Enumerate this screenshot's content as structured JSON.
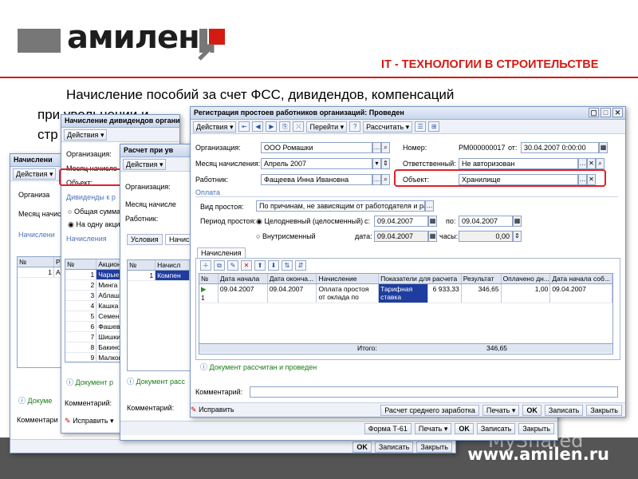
{
  "header": {
    "logo": "амилен",
    "tagline": "IT - ТЕХНОЛОГИИ В СТРОИТЕЛЬСТВЕ",
    "brand_color": "#d51a12"
  },
  "slide_title": "Начисление пособий за счет ФСС, дивидендов, компенсаций при увольнении и регистрация простоев по причинам, не зависящим от работодателя и работника стр",
  "slide_title_line1": "Начисление пособий за счет ФСС, дивидендов, компенсаций",
  "slide_title_line2": "при увольнении и",
  "slide_title_line3": "стр",
  "win1": {
    "title": "Начислени",
    "actions": "Действия",
    "org_label": "Организа",
    "month_label": "Месяц начис",
    "section": "Начислени",
    "col_n": "№",
    "row_n": "1",
    "info": "Докуме",
    "comment_label": "Комментари"
  },
  "win2": {
    "title": "Начисление дивидендов организ",
    "actions": "Действия",
    "org_label": "Организация:",
    "month_label": "Месяц начисле",
    "object_label": "Объект:",
    "div_section": "Дивиденды к р",
    "radio1": "Общая сумма",
    "radio2": "На одну акцию",
    "section": "Начисления",
    "col_n": "№",
    "col_s": "Акцион",
    "rows": [
      {
        "n": "1",
        "name": "Чарые"
      },
      {
        "n": "2",
        "name": "Минга"
      },
      {
        "n": "3",
        "name": "Аблаш"
      },
      {
        "n": "4",
        "name": "Кашка"
      },
      {
        "n": "5",
        "name": "Семен"
      },
      {
        "n": "6",
        "name": "Фашев"
      },
      {
        "n": "7",
        "name": "Шишки"
      },
      {
        "n": "8",
        "name": "Бакино"
      },
      {
        "n": "9",
        "name": "Малков"
      }
    ],
    "info": "Документ р",
    "comment_label": "Комментарий:",
    "fix": "Исправить"
  },
  "win3": {
    "title": "Расчет при ув",
    "actions": "Действия",
    "org_label": "Организация:",
    "month_label": "Месяц начисле",
    "worker_label": "Работник:",
    "tab1": "Условия",
    "tab2": "Начис",
    "col_n": "№",
    "col_name": "Начисл",
    "row_n": "1",
    "row_name": "Компен",
    "info": "Документ расс",
    "comment_label": "Комментарий:",
    "form_btn": "Форма Т-61",
    "print_btn": "Печать",
    "ok": "OK",
    "save": "Записать",
    "close": "Закрыть"
  },
  "win4": {
    "title": "Регистрация простоев работников организаций: Проведен",
    "actions": "Действия",
    "goto": "Перейти",
    "calc": "Рассчитать",
    "org_label": "Организация:",
    "org_value": "ООО Ромашки",
    "month_label": "Месяц начисления:",
    "month_value": "Апрель 2007",
    "worker_label": "Работник:",
    "worker_value": "Фащеева Инна Ивановна",
    "number_label": "Номер:",
    "number_value": "РМ000000017",
    "from_label": "от:",
    "date_value": "30.04.2007 0:00:00",
    "resp_label": "Ответственный:",
    "resp_value": "Не авторизован",
    "object_label": "Объект:",
    "object_value": "Хранилище",
    "pay_section": "Оплата",
    "idle_type_label": "Вид простоя:",
    "idle_type_value": "По причинам, не зависящим от работодателя и рабо",
    "period_label": "Период простоя:",
    "full_day": "Целодневный (целосменный)",
    "s_label": "с:",
    "s_value": "09.04.2007",
    "po_label": "по:",
    "po_value": "09.04.2007",
    "intra_shift": "Внутрисменный",
    "date_label": "дата:",
    "date_v": "09.04.2007",
    "hours_label": "часы:",
    "hours_value": "0,00",
    "tab": "Начисления",
    "cols": [
      "№",
      "Дата начала",
      "Дата оконча...",
      "Начисление",
      "Показатели для расчета",
      "Результат",
      "Оплачено дн...",
      "Дата начала соб..."
    ],
    "row": {
      "n": "1",
      "start": "09.04.2007",
      "end": "09.04.2007",
      "accrual": "Оплата простоя от оклада по",
      "indicator": "Тарифная ставка",
      "indicator_value": "6 933,33",
      "result": "346,65",
      "paid_days": "1,00",
      "event_start": "09.04.2007"
    },
    "total_label": "Итого:",
    "total_value": "346,65",
    "info": "Документ рассчитан и проведен",
    "comment_label": "Комментарий:",
    "fix": "Исправить",
    "avg_btn": "Расчет среднего заработка",
    "print_btn": "Печать",
    "ok": "OK",
    "save": "Записать",
    "close": "Закрыть"
  },
  "win1_footer": {
    "ok": "OK",
    "save": "Записать",
    "close": "Закрыть"
  },
  "footer": {
    "url": "www.amilen.ru",
    "watermark": "MyShared"
  }
}
